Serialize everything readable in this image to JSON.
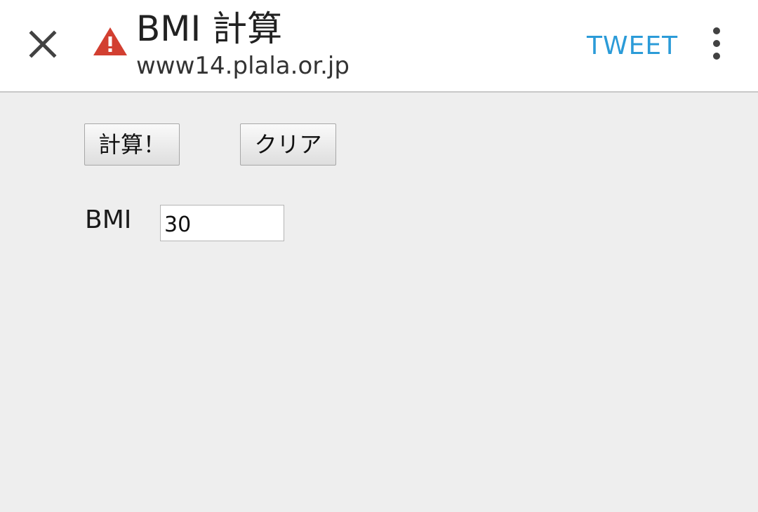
{
  "header": {
    "title": "BMI 計算",
    "url": "www14.plala.or.jp",
    "tweet_label": "TWEET",
    "warning_color": "#d23f31",
    "tweet_color": "#2b9bd8"
  },
  "icons": {
    "close": "close-icon",
    "warning": "warning-icon",
    "menu": "more-vert-icon"
  },
  "form": {
    "calc_button": "計算！",
    "clear_button": "クリア",
    "bmi_label": "BMI",
    "bmi_value": "30"
  }
}
